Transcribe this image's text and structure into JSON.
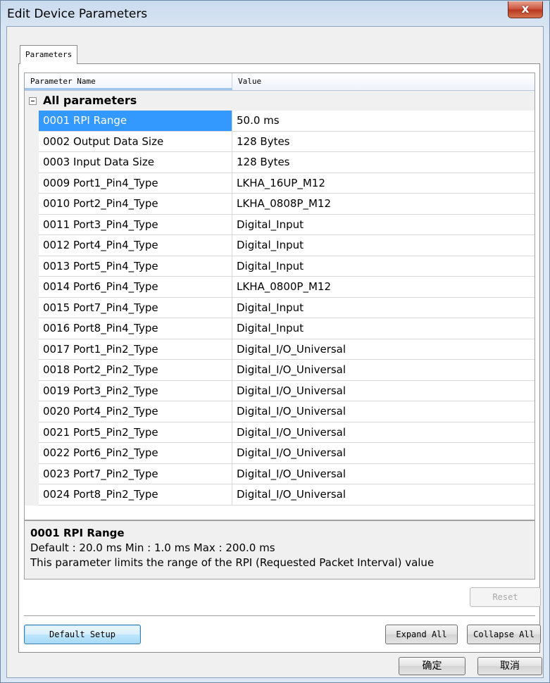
{
  "window": {
    "title": "Edit Device Parameters",
    "close_label": "x"
  },
  "tabs": [
    {
      "label": "Parameters"
    }
  ],
  "grid": {
    "columns": {
      "name": "Parameter Name",
      "value": "Value"
    },
    "group_label": "All parameters",
    "rows": [
      {
        "name": "0001 RPI Range",
        "value": "50.0 ms"
      },
      {
        "name": "0002 Output Data Size",
        "value": "128 Bytes"
      },
      {
        "name": "0003 Input Data Size",
        "value": "128 Bytes"
      },
      {
        "name": "0009 Port1_Pin4_Type",
        "value": "LKHA_16UP_M12"
      },
      {
        "name": "0010 Port2_Pin4_Type",
        "value": "LKHA_0808P_M12"
      },
      {
        "name": "0011 Port3_Pin4_Type",
        "value": "Digital_Input"
      },
      {
        "name": "0012 Port4_Pin4_Type",
        "value": "Digital_Input"
      },
      {
        "name": "0013 Port5_Pin4_Type",
        "value": "Digital_Input"
      },
      {
        "name": "0014 Port6_Pin4_Type",
        "value": "LKHA_0800P_M12"
      },
      {
        "name": "0015 Port7_Pin4_Type",
        "value": "Digital_Input"
      },
      {
        "name": "0016 Port8_Pin4_Type",
        "value": "Digital_Input"
      },
      {
        "name": "0017 Port1_Pin2_Type",
        "value": "Digital_I/O_Universal"
      },
      {
        "name": "0018 Port2_Pin2_Type",
        "value": "Digital_I/O_Universal"
      },
      {
        "name": "0019 Port3_Pin2_Type",
        "value": "Digital_I/O_Universal"
      },
      {
        "name": "0020 Port4_Pin2_Type",
        "value": "Digital_I/O_Universal"
      },
      {
        "name": "0021 Port5_Pin2_Type",
        "value": "Digital_I/O_Universal"
      },
      {
        "name": "0022 Port6_Pin2_Type",
        "value": "Digital_I/O_Universal"
      },
      {
        "name": "0023 Port7_Pin2_Type",
        "value": "Digital_I/O_Universal"
      },
      {
        "name": "0024 Port8_Pin2_Type",
        "value": "Digital_I/O_Universal"
      }
    ],
    "selected_index": 0
  },
  "description": {
    "title": "0001 RPI Range",
    "limits": "Default : 20.0 ms  Min : 1.0 ms  Max : 200.0 ms",
    "text": "This parameter limits the range of the RPI (Requested Packet Interval) value"
  },
  "buttons": {
    "reset": "Reset",
    "default_setup": "Default Setup",
    "expand_all": "Expand All",
    "collapse_all": "Collapse All",
    "ok": "确定",
    "cancel": "取消"
  },
  "colors": {
    "selection": "#3399ff",
    "close_button": "#c9503a"
  },
  "icons": {
    "group_toggle": "collapse-minus-icon"
  }
}
